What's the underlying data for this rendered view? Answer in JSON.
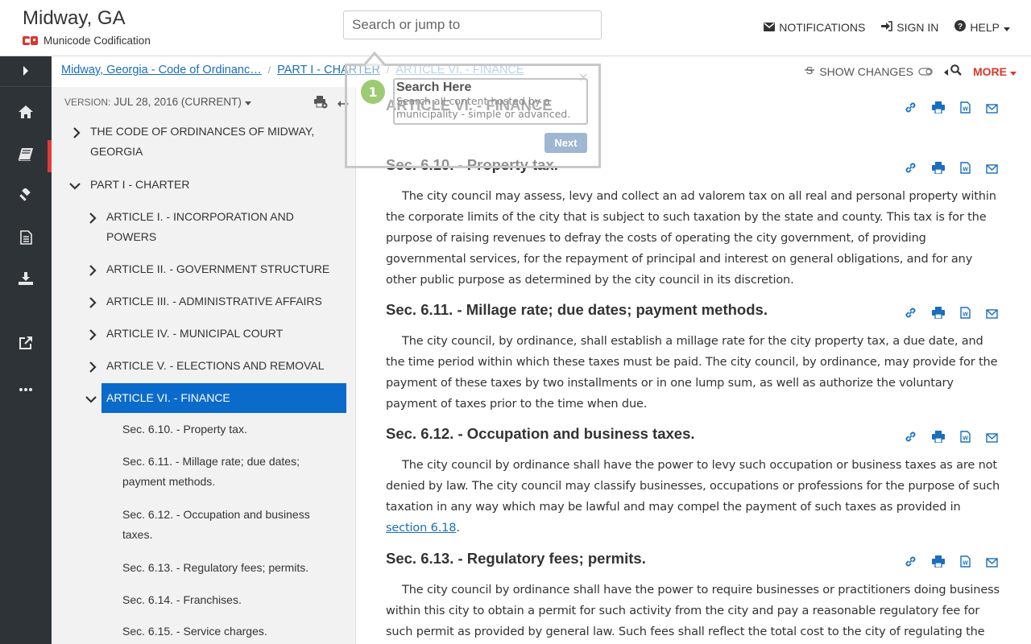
{
  "header": {
    "site_title": "Midway, GA",
    "brand": "Municode Codification",
    "search_placeholder": "Search or jump to",
    "notifications": "NOTIFICATIONS",
    "sign_in": "SIGN IN",
    "help": "HELP"
  },
  "breadcrumb": {
    "items": [
      "Midway, Georgia - Code of Ordinanc…",
      "PART I - CHARTER",
      "ARTICLE VI. - FINANCE"
    ],
    "show_changes": "SHOW CHANGES",
    "more": "MORE"
  },
  "toc": {
    "version_label": "VERSION:",
    "version_value": "JUL 28, 2016 (CURRENT)",
    "nodes": [
      {
        "label": "THE CODE OF ORDINANCES OF MIDWAY,",
        "label2": "GEORGIA"
      },
      {
        "label": "PART I - CHARTER"
      },
      {
        "label": "ARTICLE I. - INCORPORATION AND",
        "label2": "POWERS"
      },
      {
        "label": "ARTICLE II. - GOVERNMENT STRUCTURE"
      },
      {
        "label": "ARTICLE III. - ADMINISTRATIVE AFFAIRS"
      },
      {
        "label": "ARTICLE IV. - MUNICIPAL COURT"
      },
      {
        "label": "ARTICLE V. - ELECTIONS AND REMOVAL"
      },
      {
        "label": "ARTICLE VI. - FINANCE"
      },
      {
        "label": "Sec. 6.10. - Property tax."
      },
      {
        "label": "Sec. 6.11. - Millage rate; due dates;",
        "label2": "payment methods."
      },
      {
        "label": "Sec. 6.12. - Occupation and business",
        "label2": "taxes."
      },
      {
        "label": "Sec. 6.13. - Regulatory fees; permits."
      },
      {
        "label": "Sec. 6.14. - Franchises."
      },
      {
        "label": "Sec. 6.15. - Service charges."
      }
    ]
  },
  "content": {
    "article_title": "ARTICLE VI. - FINANCE",
    "sections": [
      {
        "title": "Sec. 6.10. - Property tax.",
        "text": "The city council may assess, levy and collect an ad valorem tax on all real and personal property within the corporate limits of the city that is subject to such taxation by the state and county. This tax is for the purpose of raising revenues to defray the costs of operating the city government, of providing governmental services, for the repayment of principal and interest on general obligations, and for any other public purpose as determined by the city council in its discretion."
      },
      {
        "title": "Sec. 6.11. - Millage rate; due dates; payment methods.",
        "text": "The city council, by ordinance, shall establish a millage rate for the city property tax, a due date, and the time period within which these taxes must be paid. The city council, by ordinance, may provide for the payment of these taxes by two installments or in one lump sum, as well as authorize the voluntary payment of taxes prior to the time when due."
      },
      {
        "title": "Sec. 6.12. - Occupation and business taxes.",
        "text": "The city council by ordinance shall have the power to levy such occupation or business taxes as are not denied by law. The city council may classify businesses, occupations or professions for the purpose of such taxation in any way which may be lawful and may compel the payment of such taxes as provided in ",
        "link": "section 6.18",
        "text_end": "."
      },
      {
        "title": "Sec. 6.13. - Regulatory fees; permits.",
        "text": "The city council by ordinance shall have the power to require businesses or practitioners doing business within this city to obtain a permit for such activity from the city and pay a reasonable regulatory fee for such permit as provided by general law. Such fees shall reflect the total cost to the city of regulating the activity, and"
      }
    ]
  },
  "tour": {
    "step": "1",
    "title": "Search Here",
    "text": "Search all content hosted by a municipality - simple or advanced.",
    "next": "Next",
    "close": "×"
  },
  "colors": {
    "accent_blue": "#0b6bcb",
    "more_red": "#d9372e",
    "rail_bg": "#2e3338",
    "tour_green": "#8cc25a"
  }
}
